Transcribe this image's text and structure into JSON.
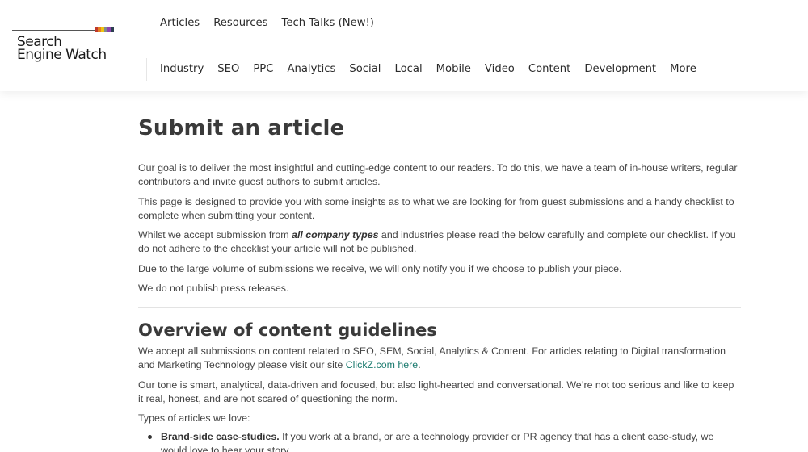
{
  "brand": {
    "name_line1": "Search",
    "name_line2": "Engine Watch",
    "stripe_colors": [
      "#c0392b",
      "#e67e22",
      "#f1c40f",
      "#7f8c8d",
      "#8e44ad",
      "#2c3e50"
    ]
  },
  "top_nav": [
    "Articles",
    "Resources",
    "Tech Talks (New!)"
  ],
  "main_nav": [
    "Industry",
    "SEO",
    "PPC",
    "Analytics",
    "Social",
    "Local",
    "Mobile",
    "Video",
    "Content",
    "Development",
    "More"
  ],
  "article": {
    "title": "Submit an article",
    "p1": "Our goal is to deliver the most insightful and cutting-edge content to our readers. To do this, we have a team of in-house writers, regular contributors and invite guest authors to submit articles.",
    "p2": "This page is designed to provide you with some insights as to what we are looking for from guest submissions and a handy checklist to complete when submitting your content.",
    "p3_before": "Whilst we accept submission from ",
    "p3_bold": "all company types",
    "p3_after": " and industries please read the below carefully and complete our checklist. If you do not adhere to the checklist your article will not be published.",
    "p4": "Due to the large volume of submissions we receive, we will only notify you if we choose to publish your piece.",
    "p5": "We do not publish press releases."
  },
  "guidelines": {
    "title": "Overview of content guidelines",
    "p1_before": "We accept all submissions on content related to SEO, SEM, Social, Analytics & Content. For articles relating to Digital transformation and Marketing Technology please visit our site ",
    "p1_link": "ClickZ.com here",
    "p1_after": ".",
    "p2": "Our tone is smart, analytical, data-driven and focused, but also light-hearted and conversational. We’re not too serious and like to keep it real, honest, and are not scared of questioning the norm.",
    "types_label": "Types of articles we love:",
    "bullet_strong": "Brand-side case-studies.",
    "bullet_text": " If you work at a brand, or are a technology provider or PR agency that has a client case-study, we would love to hear your story."
  },
  "colors": {
    "link": "#1a7a6e",
    "text": "#444444",
    "heading": "#3a3a3a"
  }
}
